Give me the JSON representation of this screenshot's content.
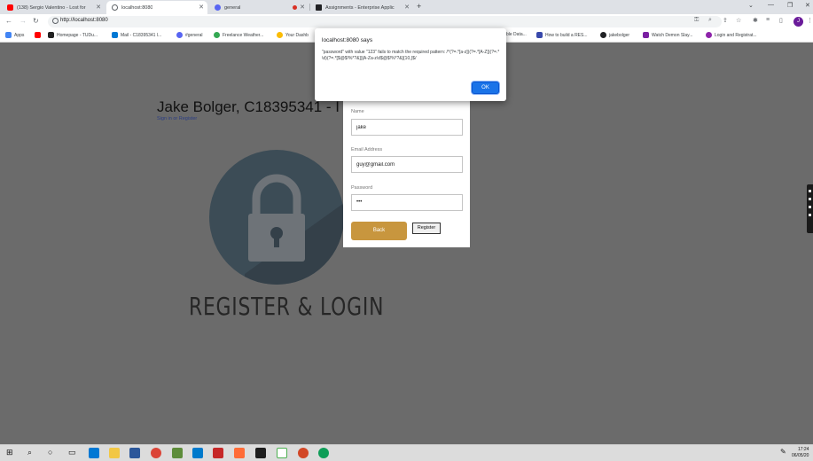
{
  "tabs": [
    {
      "label": "(138) Sergio Valentino - Lost for",
      "icon": "youtube-icon",
      "color": "#ff0000"
    },
    {
      "label": "localhost:8080",
      "icon": "globe-icon",
      "color": "#5f6368"
    },
    {
      "label": "general",
      "icon": "discord-icon",
      "color": "#5865f2"
    },
    {
      "label": "Assignments - Enterprise Applic",
      "icon": "site-icon",
      "color": "#202124"
    }
  ],
  "toolbar": {
    "url": "http://localhost:8080",
    "profile_initial": "J"
  },
  "bookmarks": [
    {
      "label": "Apps",
      "color": "#4285f4"
    },
    {
      "label": "",
      "color": "#ff0000"
    },
    {
      "label": "Homepage - TUDu...",
      "color": "#222222"
    },
    {
      "label": "Mail - C18395341 l...",
      "color": "#0078d4"
    },
    {
      "label": "#general",
      "color": "#5865f2"
    },
    {
      "label": "Freelance Weather...",
      "color": "#34a853"
    },
    {
      "label": "Your Dashb",
      "color": "#fbbc04"
    },
    {
      "label": "ble Data...",
      "color": "#9aa0a6"
    },
    {
      "label": "How to build a RES...",
      "color": "#3949ab"
    },
    {
      "label": "jakebolger",
      "color": "#202124"
    },
    {
      "label": "Watch Demon Slay...",
      "color": "#7b1fa2"
    },
    {
      "label": "Login and Registrat...",
      "color": "#8e24aa"
    }
  ],
  "page": {
    "title": "Jake Bolger, C18395341 - I",
    "link": "Sign in or Register",
    "logo_text": "REGISTER & LOGIN"
  },
  "form": {
    "name_label": "Name",
    "name_value": "jake",
    "email_label": "Email Address",
    "email_value": "guy@gmail.com",
    "password_label": "Password",
    "password_value": "•••",
    "back_label": "Back",
    "register_label": "Register"
  },
  "dialog": {
    "title": "localhost:8080 says",
    "message": "\"password\" with value \"123\" fails to match the required pattern: /^(?=.*[a-z])(?=.*[A-Z])(?=.*\\d)(?=.*[$@$!%*?&])[A-Za-z\\d$@$!%*?&]{10,}$/",
    "ok_label": "OK"
  },
  "taskbar": {
    "time": "17:24",
    "date": "06/05/20"
  }
}
